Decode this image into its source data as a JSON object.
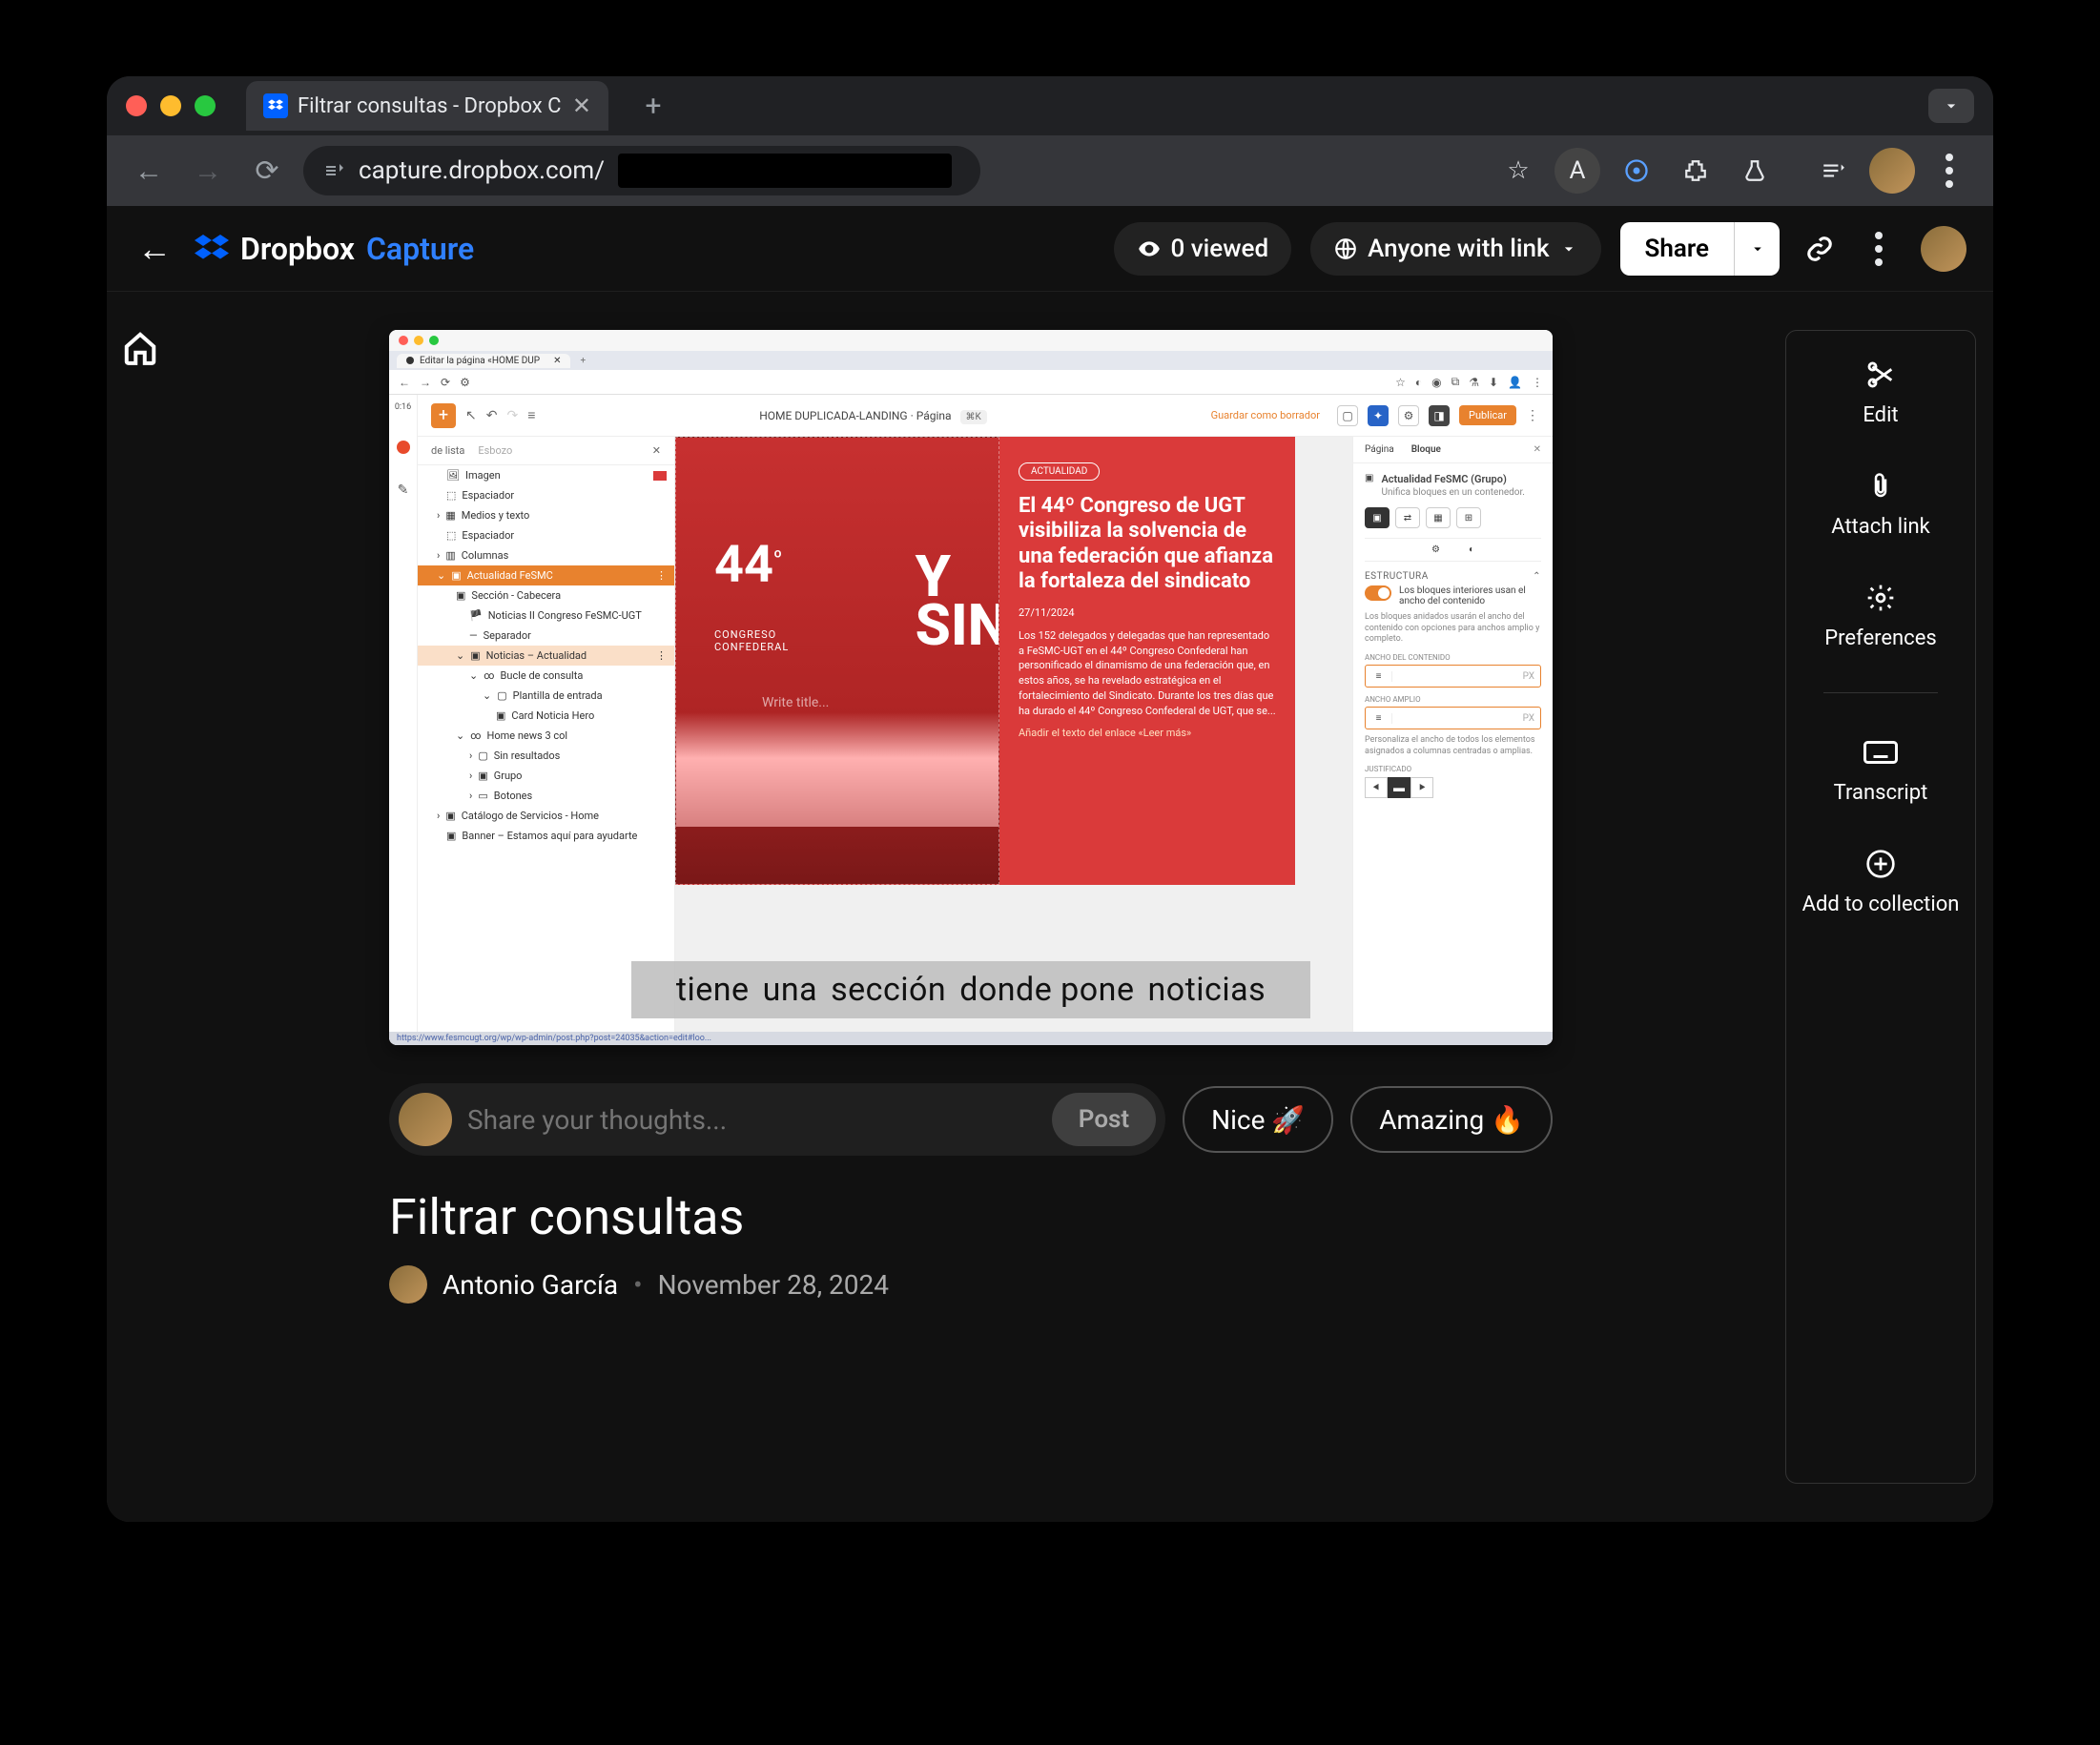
{
  "browser": {
    "tab_title": "Filtrar consultas - Dropbox C",
    "url_visible": "capture.dropbox.com/"
  },
  "header": {
    "logo_dropbox": "Dropbox",
    "logo_capture": "Capture",
    "viewed": "0 viewed",
    "visibility": "Anyone with link",
    "share": "Share"
  },
  "thumbnail": {
    "inner_tab": "Editar la página «HOME DUP",
    "time": "0:16",
    "doc_title": "HOME DUPLICADA-LANDING · Página",
    "kbd": "⌘K",
    "save_draft": "Guardar como borrador",
    "publish": "Publicar",
    "tree_header_a": "de lista",
    "tree_header_b": "Esbozo",
    "tree": [
      "Imagen",
      "Espaciador",
      "Medios y texto",
      "Espaciador",
      "Columnas",
      "Actualidad FeSMC",
      "Sección - Cabecera",
      "Noticias II Congreso FeSMC-UGT",
      "Separador",
      "Noticias – Actualidad",
      "Bucle de consulta",
      "Plantilla de entrada",
      "Card Noticia Hero",
      "Home news 3 col",
      "Sin resultados",
      "Grupo",
      "Botones",
      "Catálogo de Servicios - Home",
      "Banner – Estamos aquí para ayudarte"
    ],
    "hero": {
      "badge": "ACTUALIDAD",
      "big44": "44",
      "big44_sup": "º",
      "congreso": "CONGRESO\nCONFEDERAL",
      "y_sin": "Y\nSIN",
      "write_title": "Write title...",
      "headline": "El 44º Congreso de UGT visibiliza la solvencia de una federación que afianza la fortaleza del sindicato",
      "date": "27/11/2024",
      "body": "Los 152 delegados y delegadas que han representado a FeSMC-UGT en el 44º Congreso Confederal han personificado el dinamismo de una federación que, en estos años, se ha revelado estratégica en el fortalecimiento del Sindicato. Durante los tres días que ha durado el 44º Congreso Confederal de UGT, que se...",
      "link": "Añadir el texto del enlace «Leer más»"
    },
    "inspector": {
      "tab_a": "Página",
      "tab_b": "Bloque",
      "title": "Actualidad FeSMC (Grupo)",
      "subtitle": "Unifica bloques en un contenedor.",
      "section": "Estructura",
      "toggle_label": "Los bloques interiores usan el ancho del contenido",
      "help": "Los bloques anidados usarán el ancho del contenido con opciones para anchos amplio y completo.",
      "label_content": "ANCHO DEL CONTENIDO",
      "label_wide": "ANCHO AMPLIO",
      "px": "PX",
      "personalize": "Personaliza el ancho de todos los elementos asignados a columnas centradas o amplias.",
      "label_just": "JUSTIFICADO"
    },
    "caption_words": [
      "tiene",
      "una",
      "sección",
      "donde pone",
      "noticias"
    ],
    "status_url": "https://www.fesmcugt.org/wp/wp-admin/post.php?post=24035&action=edit#loo..."
  },
  "comment": {
    "placeholder": "Share your thoughts...",
    "post": "Post",
    "react_nice": "Nice 🚀",
    "react_amazing": "Amazing 🔥"
  },
  "capture": {
    "title": "Filtrar consultas",
    "author": "Antonio García",
    "date": "November 28, 2024"
  },
  "actions": {
    "edit": "Edit",
    "attach": "Attach link",
    "prefs": "Preferences",
    "transcript": "Transcript",
    "add": "Add to collection"
  }
}
